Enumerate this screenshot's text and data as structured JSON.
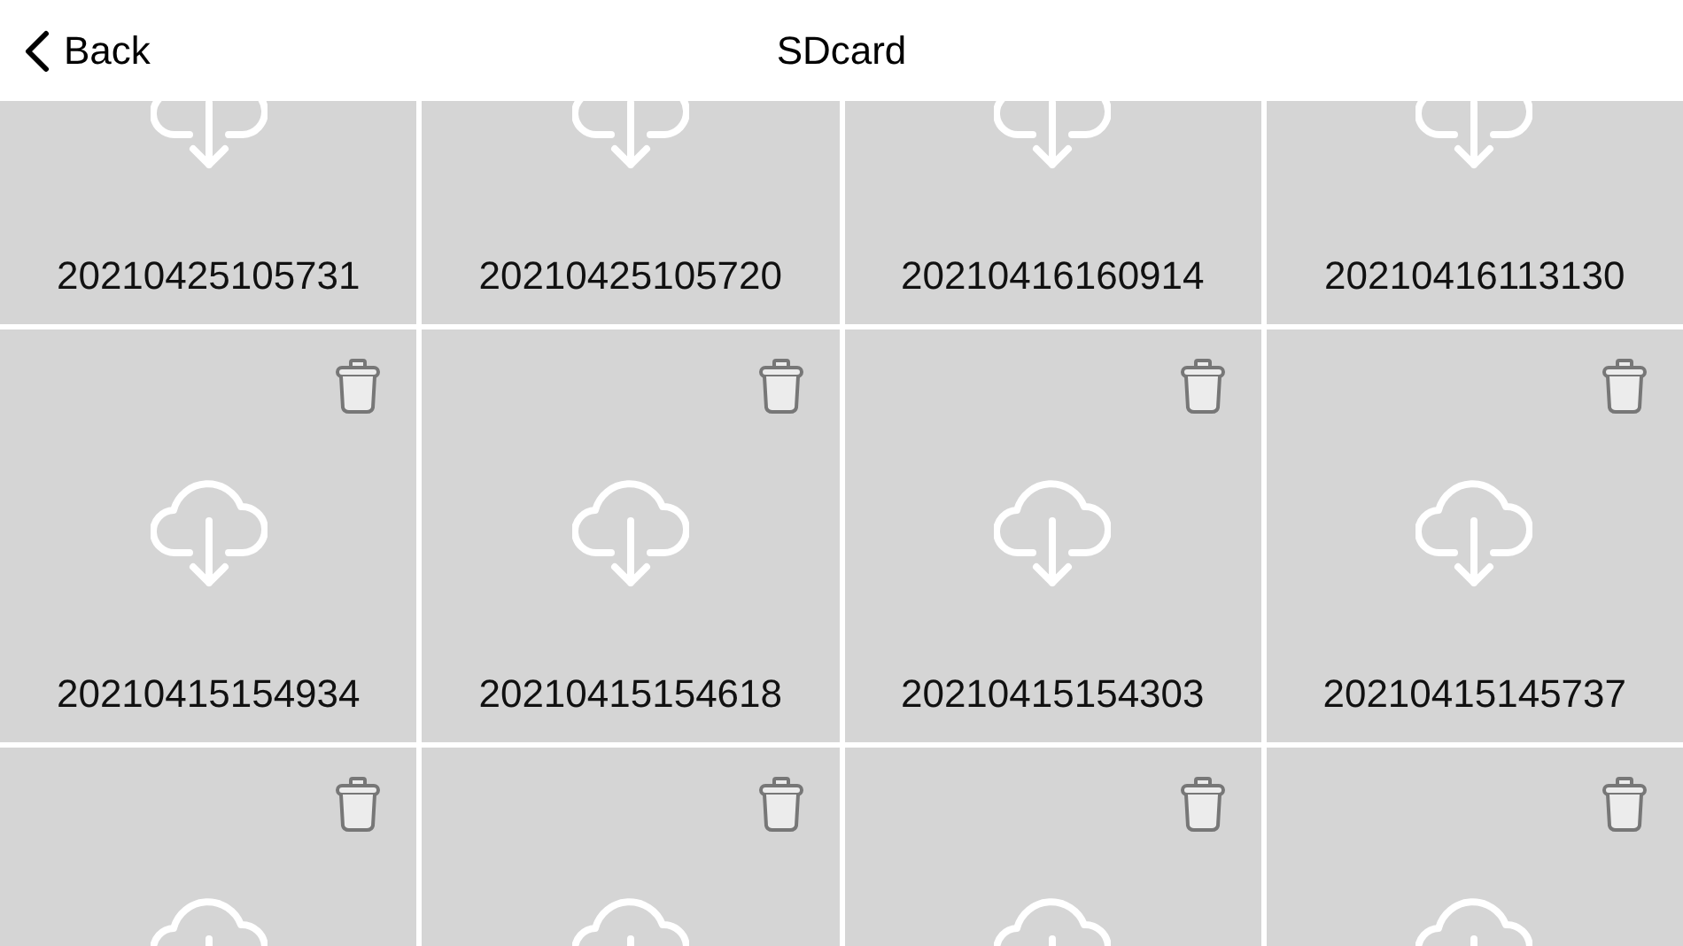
{
  "header": {
    "back": "Back",
    "title": "SDcard"
  },
  "files": [
    {
      "kind": "file",
      "name": "20210425105731"
    },
    {
      "kind": "file",
      "name": "20210425105720"
    },
    {
      "kind": "file",
      "name": "20210416160914"
    },
    {
      "kind": "file",
      "name": "20210416113130"
    },
    {
      "kind": "file",
      "name": "20210415154934"
    },
    {
      "kind": "file",
      "name": "20210415154618"
    },
    {
      "kind": "file",
      "name": "20210415154303"
    },
    {
      "kind": "file",
      "name": "20210415145737"
    },
    {
      "kind": "file"
    },
    {
      "kind": "file"
    },
    {
      "kind": "file"
    },
    {
      "kind": "file"
    }
  ]
}
